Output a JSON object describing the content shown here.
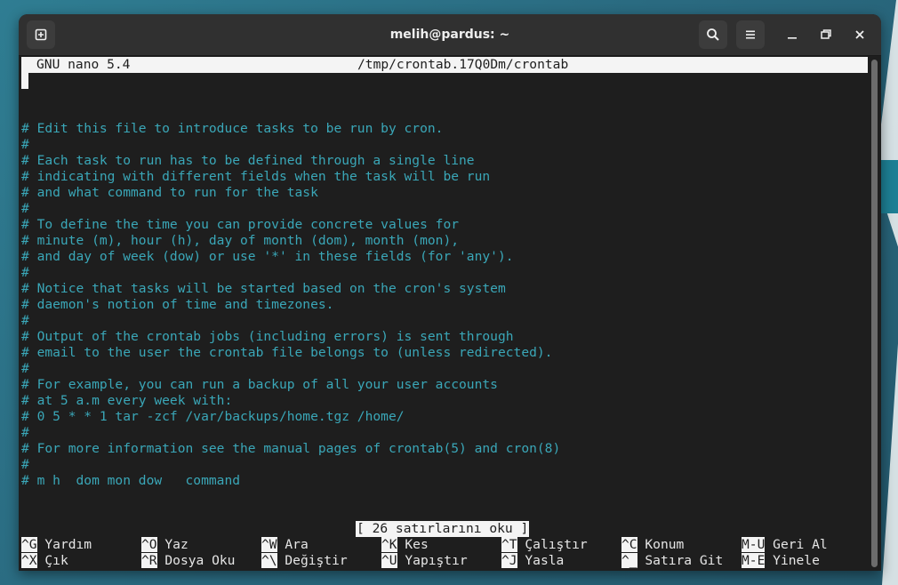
{
  "window": {
    "title": "melih@pardus: ~"
  },
  "icons": {
    "new_tab": "new-tab-icon",
    "search": "search-icon",
    "menu": "hamburger-menu-icon",
    "minimize": "minimize-icon",
    "restore": "restore-icon",
    "close": "close-icon"
  },
  "nano": {
    "version": "GNU nano 5.4",
    "file_path": "/tmp/crontab.17Q0Dm/crontab",
    "status_message": "[ 26 satırlarını oku ]",
    "lines": [
      "# Edit this file to introduce tasks to be run by cron.",
      "#",
      "# Each task to run has to be defined through a single line",
      "# indicating with different fields when the task will be run",
      "# and what command to run for the task",
      "#",
      "# To define the time you can provide concrete values for",
      "# minute (m), hour (h), day of month (dom), month (mon),",
      "# and day of week (dow) or use '*' in these fields (for 'any').",
      "#",
      "# Notice that tasks will be started based on the cron's system",
      "# daemon's notion of time and timezones.",
      "#",
      "# Output of the crontab jobs (including errors) is sent through",
      "# email to the user the crontab file belongs to (unless redirected).",
      "#",
      "# For example, you can run a backup of all your user accounts",
      "# at 5 a.m every week with:",
      "# 0 5 * * 1 tar -zcf /var/backups/home.tgz /home/",
      "#",
      "# For more information see the manual pages of crontab(5) and cron(8)",
      "#",
      "# m h  dom mon dow   command"
    ],
    "shortcuts_row1": [
      {
        "key": "^G",
        "label": "Yardım"
      },
      {
        "key": "^O",
        "label": "Yaz"
      },
      {
        "key": "^W",
        "label": "Ara"
      },
      {
        "key": "^K",
        "label": "Kes"
      },
      {
        "key": "^T",
        "label": "Çalıştır"
      },
      {
        "key": "^C",
        "label": "Konum"
      },
      {
        "key": "M-U",
        "label": "Geri Al"
      }
    ],
    "shortcuts_row2": [
      {
        "key": "^X",
        "label": "Çık"
      },
      {
        "key": "^R",
        "label": "Dosya Oku"
      },
      {
        "key": "^\\",
        "label": "Değiştir"
      },
      {
        "key": "^U",
        "label": "Yapıştır"
      },
      {
        "key": "^J",
        "label": "Yasla"
      },
      {
        "key": "^_",
        "label": "Satıra Git"
      },
      {
        "key": "M-E",
        "label": "Yinele"
      }
    ]
  },
  "colors": {
    "comment": "#3aa7b8",
    "terminal_bg": "#1e1e1e",
    "titlebar_bg": "#303030",
    "inverse_bg": "#f4f4f4"
  }
}
